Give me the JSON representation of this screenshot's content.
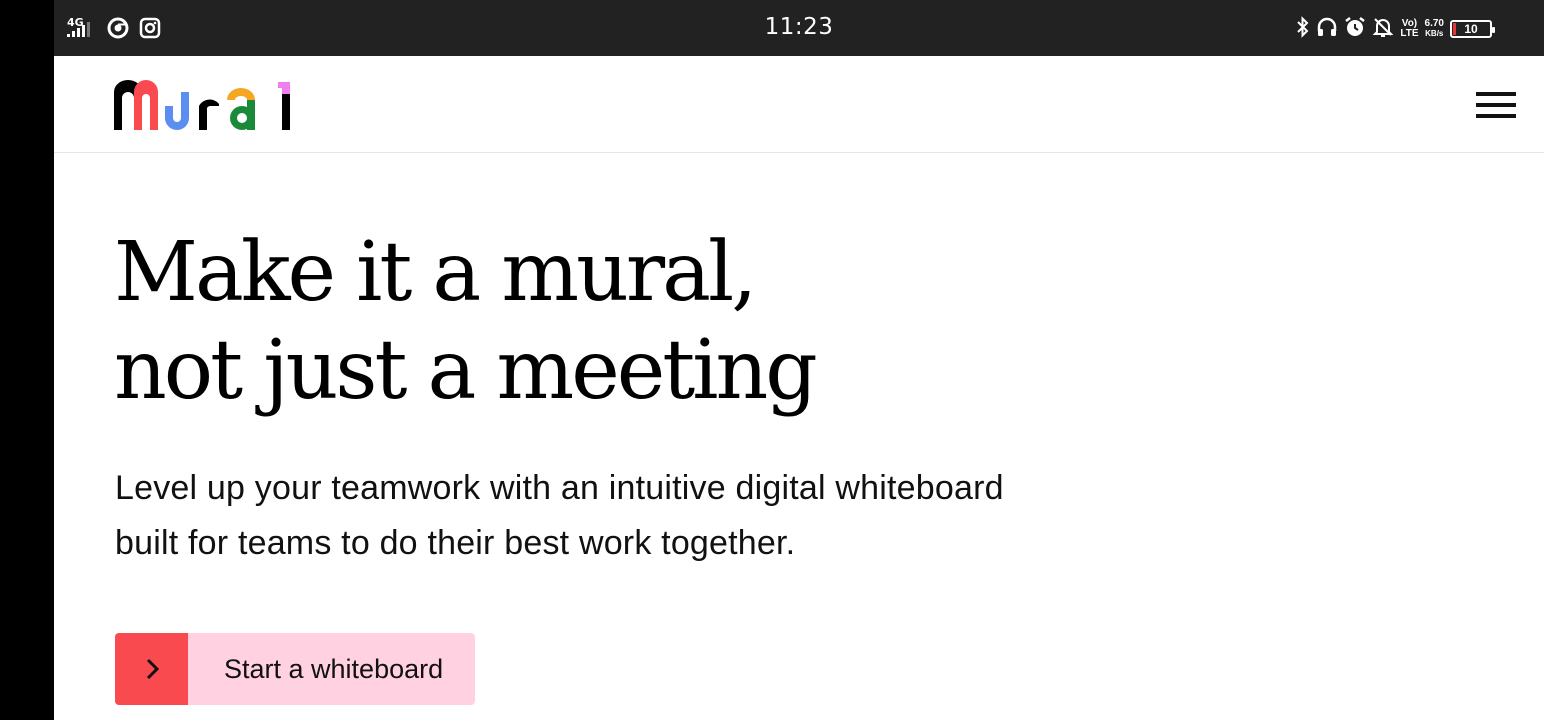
{
  "status_bar": {
    "time": "11:23",
    "network": "4G",
    "volte_top": "Vo)",
    "volte_bottom": "LTE",
    "speed_value": "6.70",
    "speed_unit": "KB/s",
    "battery": "10",
    "icons": [
      "signal-icon",
      "chrome-icon",
      "instagram-icon",
      "bluetooth-icon",
      "headphones-icon",
      "alarm-icon",
      "bell-off-icon"
    ]
  },
  "header": {
    "logo_text": "mural",
    "menu_icon": "hamburger-menu-icon"
  },
  "hero": {
    "title_line1": "Make it a mural,",
    "title_line2": "not just a meeting",
    "subtitle": "Level up your teamwork with an intuitive digital whiteboard built for teams to do their best work together.",
    "cta_label": "Start a whiteboard",
    "cta_icon": "chevron-right-icon"
  },
  "colors": {
    "cta_accent": "#f94a50",
    "cta_background": "#ffd1e1",
    "status_bar": "#222222"
  }
}
